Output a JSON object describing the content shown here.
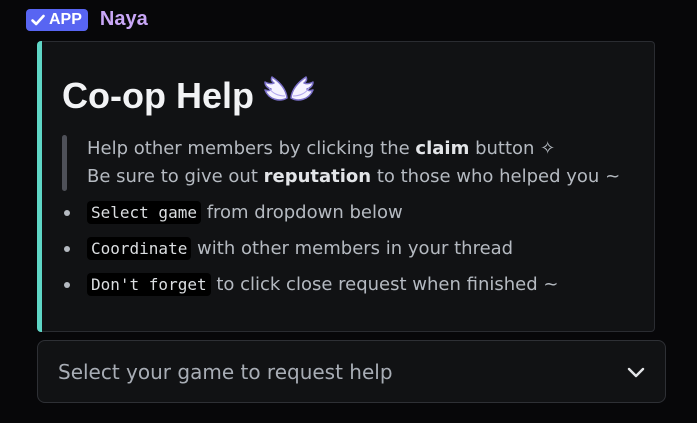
{
  "header": {
    "badge_label": "APP",
    "username": "Naya"
  },
  "embed": {
    "title": "Co-op Help",
    "title_icon": "angel-wings-icon",
    "accent_color": "#5fd6c6",
    "description": {
      "line1_pre": "Help other members by clicking the ",
      "line1_bold": "claim",
      "line1_post": " button ✧",
      "line2_pre": "Be sure to give out ",
      "line2_bold": "reputation",
      "line2_post": " to those who helped you ~"
    },
    "bullets": [
      {
        "code": "Select game",
        "text": " from dropdown below"
      },
      {
        "code": "Coordinate",
        "text": " with other members in your thread"
      },
      {
        "code": "Don't forget",
        "text": " to click close request when finished ~"
      }
    ]
  },
  "select": {
    "placeholder": "Select your game to request help",
    "icon": "chevron-down-icon"
  },
  "colors": {
    "background": "#070709",
    "badge": "#5865f2",
    "username": "#c9a7f7",
    "embed_bg": "#111214"
  }
}
